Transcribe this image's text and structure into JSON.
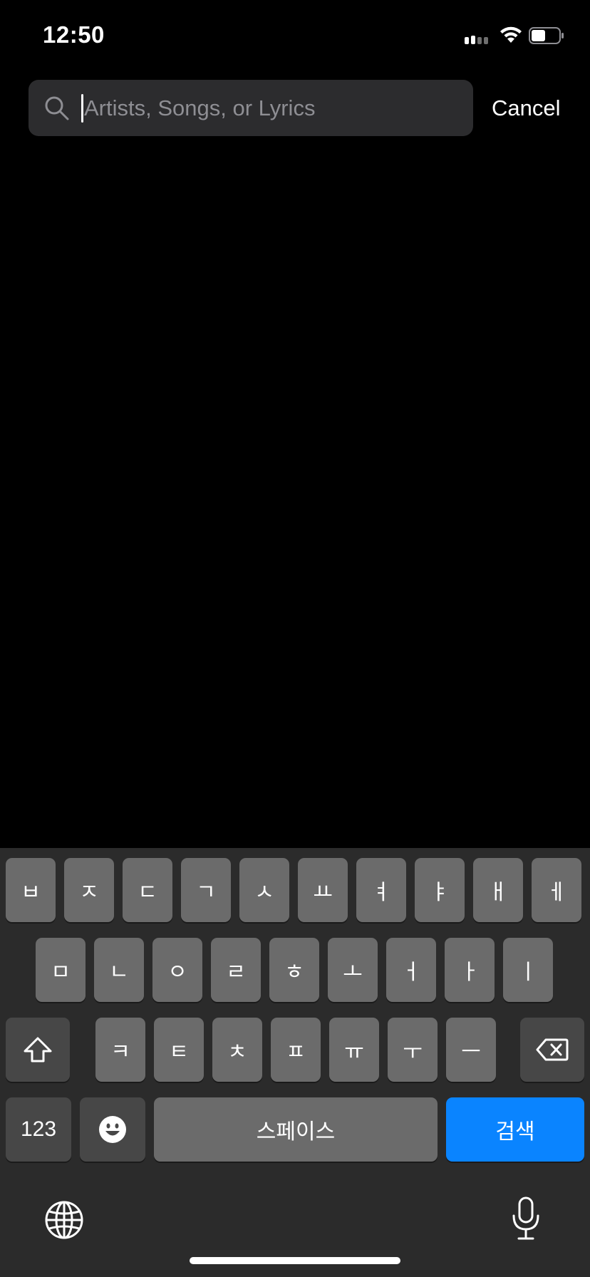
{
  "status_bar": {
    "time": "12:50",
    "battery_level": 0.5
  },
  "search": {
    "placeholder": "Artists, Songs, or Lyrics",
    "value": "",
    "cancel_label": "Cancel"
  },
  "keyboard": {
    "row1": [
      "ㅂ",
      "ㅈ",
      "ㄷ",
      "ㄱ",
      "ㅅ",
      "ㅛ",
      "ㅕ",
      "ㅑ",
      "ㅐ",
      "ㅔ"
    ],
    "row2": [
      "ㅁ",
      "ㄴ",
      "ㅇ",
      "ㄹ",
      "ㅎ",
      "ㅗ",
      "ㅓ",
      "ㅏ",
      "ㅣ"
    ],
    "row3": [
      "ㅋ",
      "ㅌ",
      "ㅊ",
      "ㅍ",
      "ㅠ",
      "ㅜ",
      "ㅡ"
    ],
    "numbers_label": "123",
    "space_label": "스페이스",
    "search_label": "검색",
    "accent_color": "#0a84ff"
  },
  "icons": {
    "search": "search-icon",
    "shift": "shift-icon",
    "delete": "delete-icon",
    "emoji": "emoji-icon",
    "globe": "globe-icon",
    "mic": "microphone-icon"
  }
}
